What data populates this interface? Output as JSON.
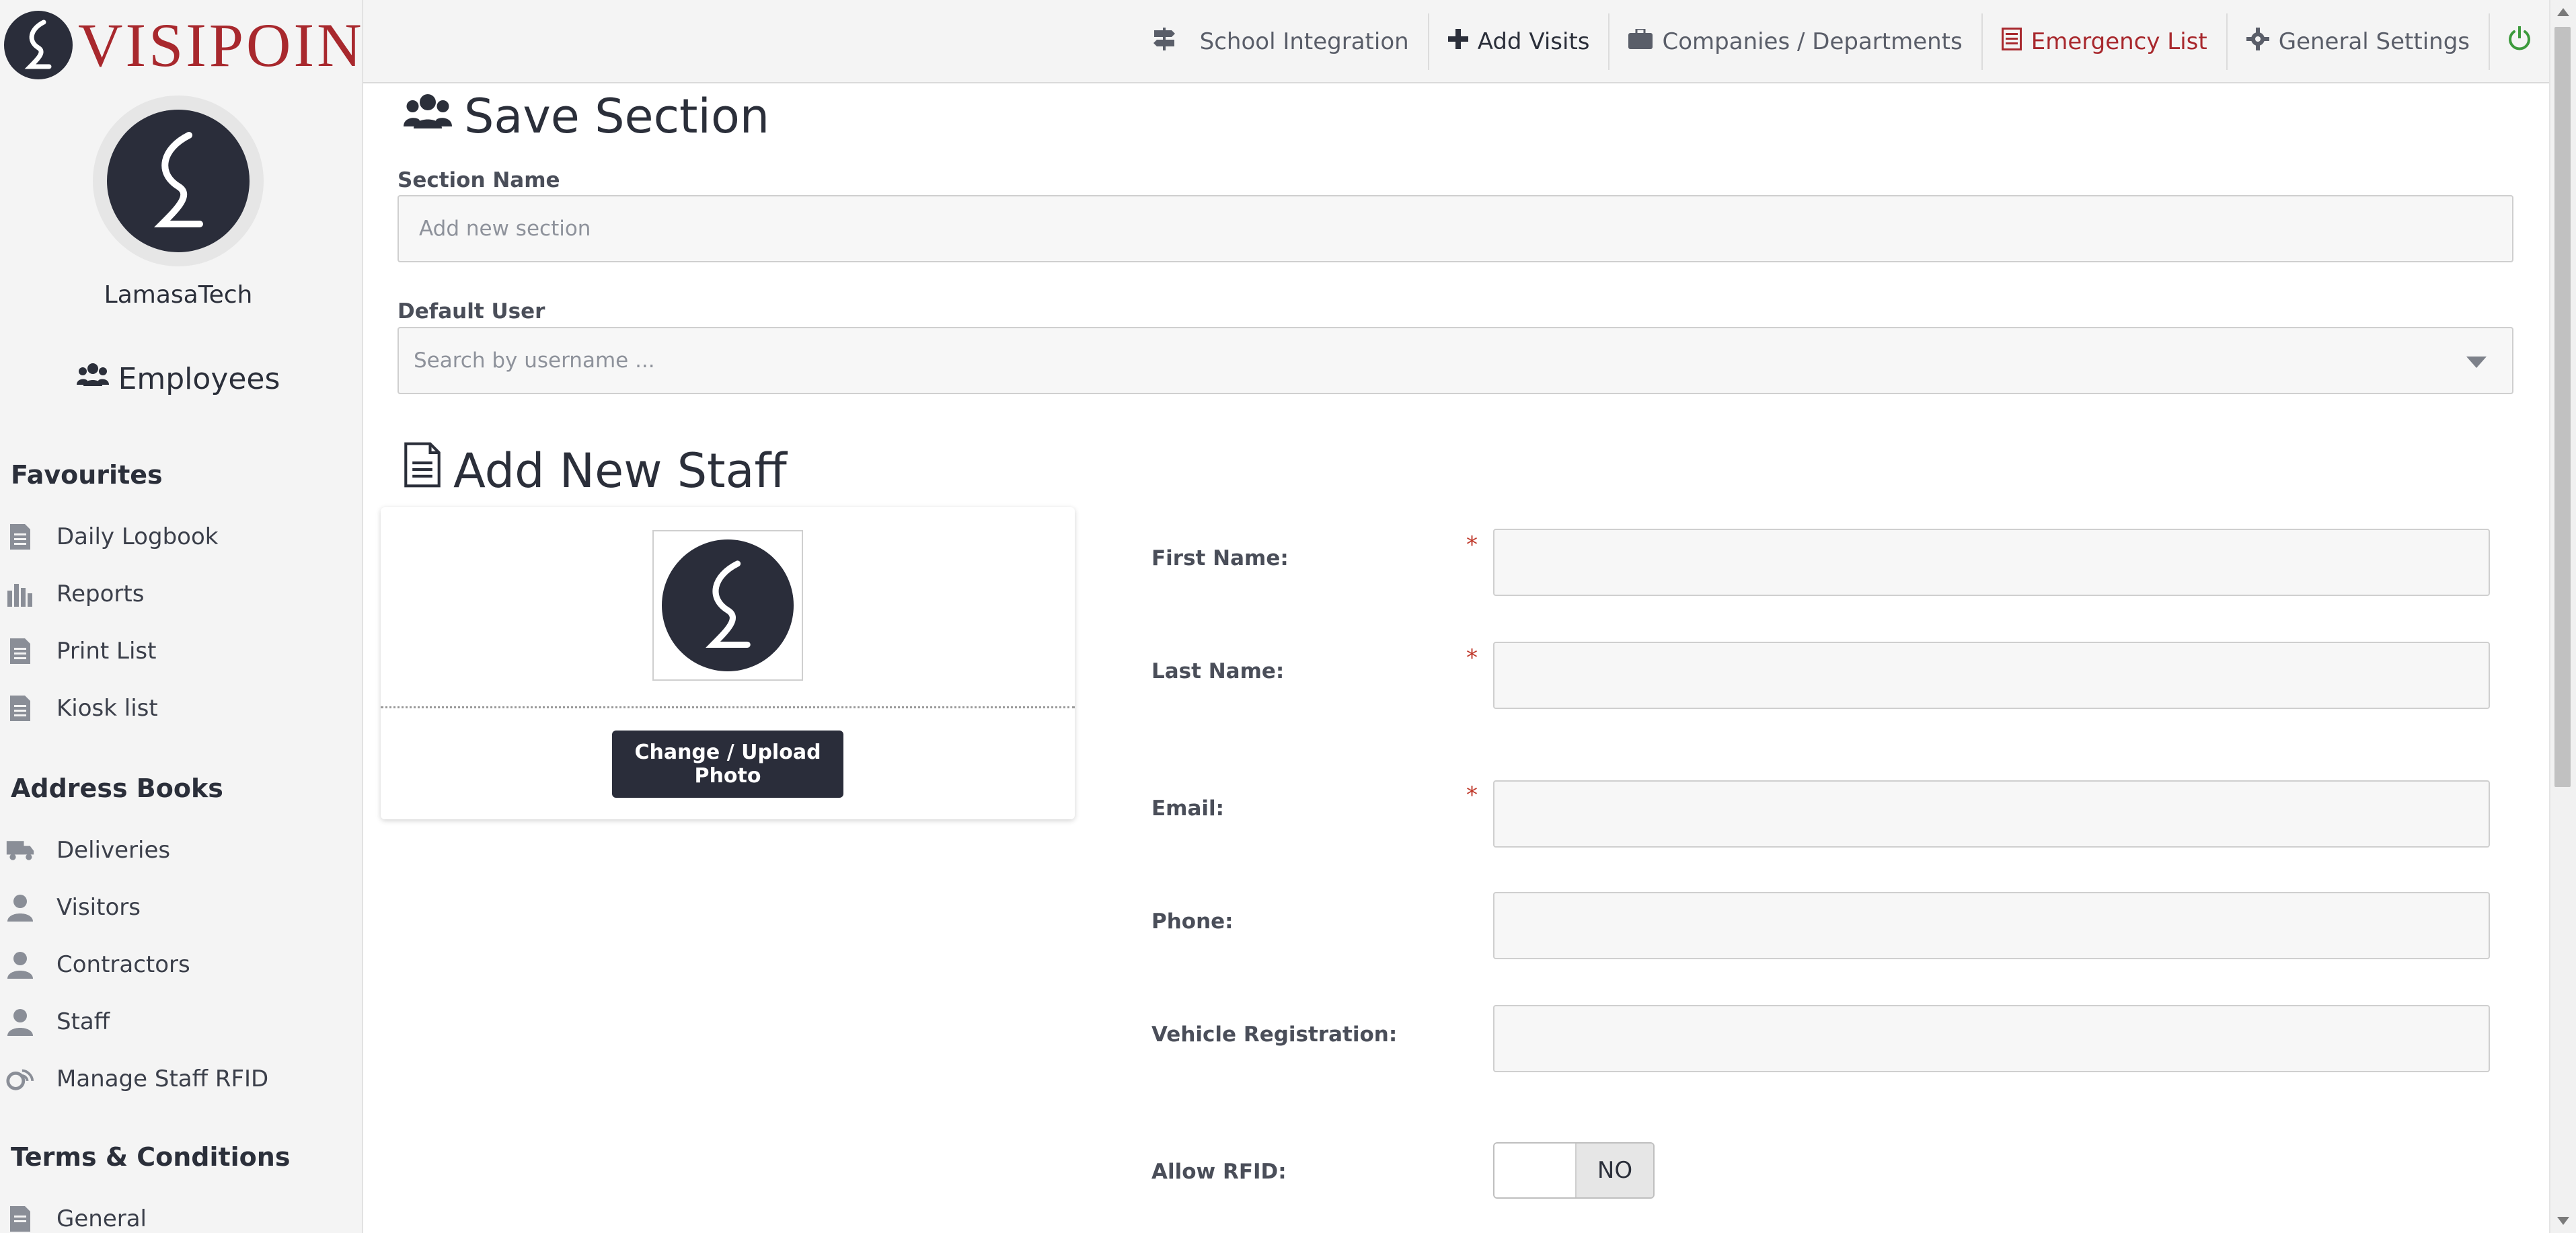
{
  "brand": {
    "name": "VISIPOINT",
    "logo_icon": "visipoint-logo-icon"
  },
  "profile": {
    "name": "LamasaTech"
  },
  "sidebar": {
    "section_label": "Employees",
    "favourites": {
      "heading": "Favourites",
      "items": [
        {
          "label": "Daily Logbook",
          "icon": "document-icon"
        },
        {
          "label": "Reports",
          "icon": "bar-chart-icon"
        },
        {
          "label": "Print List",
          "icon": "document-icon"
        },
        {
          "label": "Kiosk list",
          "icon": "document-icon"
        }
      ]
    },
    "address_books": {
      "heading": "Address Books",
      "items": [
        {
          "label": "Deliveries",
          "icon": "truck-icon"
        },
        {
          "label": "Visitors",
          "icon": "user-icon"
        },
        {
          "label": "Contractors",
          "icon": "user-icon"
        },
        {
          "label": "Staff",
          "icon": "user-icon"
        },
        {
          "label": "Manage Staff RFID",
          "icon": "rfid-icon"
        }
      ]
    },
    "terms": {
      "heading": "Terms & Conditions",
      "items": [
        {
          "label": "General",
          "icon": "document-icon"
        }
      ]
    }
  },
  "topnav": {
    "items": [
      {
        "label": "School Integration",
        "icon": "signpost-icon"
      },
      {
        "label": "Add Visits",
        "icon": "plus-icon"
      },
      {
        "label": "Companies / Departments",
        "icon": "briefcase-icon"
      },
      {
        "label": "Emergency List",
        "icon": "list-icon"
      },
      {
        "label": "General Settings",
        "icon": "gear-icon"
      }
    ],
    "power_icon": "power-icon"
  },
  "save_section": {
    "title": "Save Section",
    "section_name_label": "Section Name",
    "section_name_placeholder": "Add new section",
    "default_user_label": "Default User",
    "default_user_placeholder": "Search by username ..."
  },
  "add_staff": {
    "title": "Add New Staff",
    "upload_button": "Change / Upload Photo",
    "fields": {
      "first_name": {
        "label": "First Name:",
        "value": ""
      },
      "last_name": {
        "label": "Last Name:",
        "value": ""
      },
      "email": {
        "label": "Email:",
        "value": ""
      },
      "phone": {
        "label": "Phone:",
        "value": ""
      },
      "vehicle": {
        "label": "Vehicle Registration:",
        "value": ""
      }
    },
    "required_mark": "*",
    "allow_rfid": {
      "label": "Allow RFID:",
      "state": "NO"
    }
  },
  "colors": {
    "brand_red": "#a8282d",
    "dark_navy": "#2a2d3a",
    "sidebar_bg": "#f4f4f4",
    "required_red": "#c0392b"
  }
}
